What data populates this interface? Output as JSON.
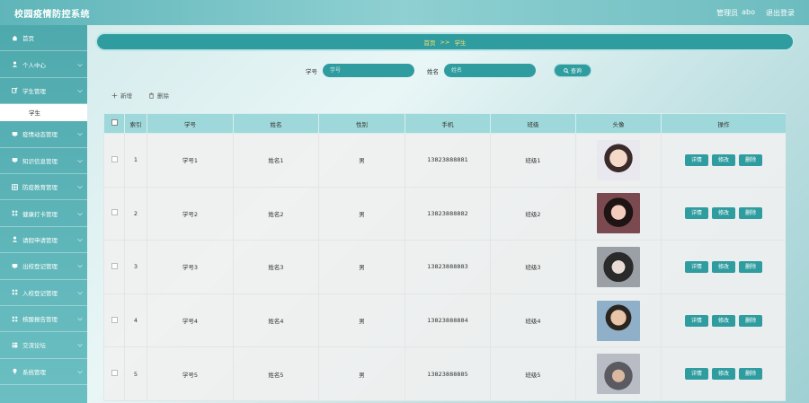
{
  "app": {
    "title": "校园疫情防控系统"
  },
  "topbar": {
    "role": "管理员",
    "user": "abo",
    "logout": "退出登录"
  },
  "sidebar": {
    "items": [
      {
        "label": "首页",
        "icon": "home-icon"
      },
      {
        "label": "个人中心",
        "icon": "user-icon"
      },
      {
        "label": "学生管理",
        "icon": "edit-icon"
      }
    ],
    "active_sub": "学生",
    "items_after": [
      {
        "label": "疫情动态管理",
        "icon": "monitor-icon"
      },
      {
        "label": "知识信息管理",
        "icon": "monitor-icon"
      },
      {
        "label": "防疫教育管理",
        "icon": "grid-icon"
      },
      {
        "label": "健康打卡管理",
        "icon": "apps-icon"
      },
      {
        "label": "请假申请管理",
        "icon": "user-icon"
      },
      {
        "label": "出校登记管理",
        "icon": "monitor-icon"
      },
      {
        "label": "入校登记管理",
        "icon": "apps-icon"
      },
      {
        "label": "核酸报告管理",
        "icon": "apps-icon"
      },
      {
        "label": "交流论坛",
        "icon": "table-icon"
      },
      {
        "label": "系统管理",
        "icon": "bulb-icon"
      }
    ]
  },
  "breadcrumb": {
    "home": "首页",
    "sep": ">>",
    "current": "学生"
  },
  "search": {
    "field1_label": "学号",
    "field1_placeholder": "学号",
    "field2_label": "姓名",
    "field2_placeholder": "姓名",
    "button": "查询"
  },
  "actions": {
    "add": "新增",
    "delete": "删除"
  },
  "table": {
    "headers": [
      "索引",
      "学号",
      "姓名",
      "性别",
      "手机",
      "班级",
      "头像",
      "操作"
    ],
    "rows": [
      {
        "index": "1",
        "id": "学号1",
        "name": "姓名1",
        "gender": "男",
        "phone": "13823888881",
        "class": "班级1"
      },
      {
        "index": "2",
        "id": "学号2",
        "name": "姓名2",
        "gender": "男",
        "phone": "13823888882",
        "class": "班级2"
      },
      {
        "index": "3",
        "id": "学号3",
        "name": "姓名3",
        "gender": "男",
        "phone": "13823888883",
        "class": "班级3"
      },
      {
        "index": "4",
        "id": "学号4",
        "name": "姓名4",
        "gender": "男",
        "phone": "13823888884",
        "class": "班级4"
      },
      {
        "index": "5",
        "id": "学号5",
        "name": "姓名5",
        "gender": "男",
        "phone": "13823888885",
        "class": "班级5"
      }
    ],
    "op_labels": {
      "detail": "详情",
      "edit": "修改",
      "delete": "删除"
    }
  },
  "colors": {
    "primary": "#2f9c9f",
    "header_bg": "#9fd8da",
    "breadcrumb_text": "#ffe06b",
    "sidebar": "#4ea9ad"
  }
}
